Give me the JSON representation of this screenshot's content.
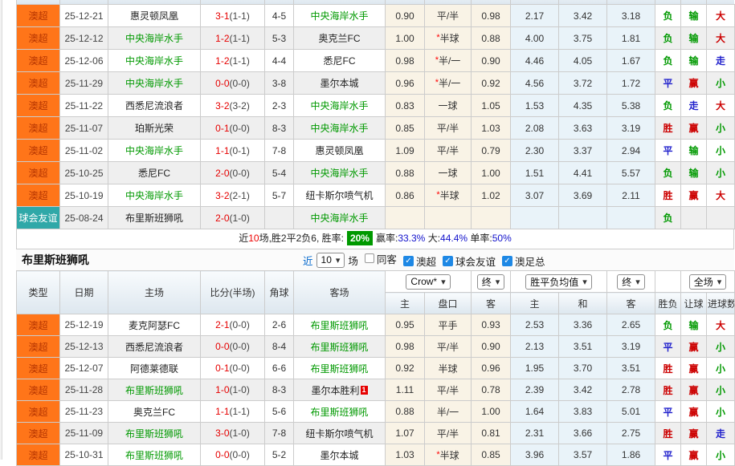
{
  "colors": {
    "league_orange": "#ff7519",
    "friendly_teal": "#2fa8a8",
    "win_red": "#cc0000",
    "draw_blue": "#2020cc",
    "lose_green": "#009900",
    "checkbox_blue": "#1e88e5",
    "rate_badge_green": "#009900"
  },
  "sub_headers": [
    "主",
    "盘口",
    "客",
    "主",
    "和",
    "客",
    "胜负",
    "让球",
    "进球数"
  ],
  "top_table": {
    "rows": [
      {
        "league": "澳超",
        "league_type": "super",
        "date": "25-12-21",
        "home": "惠灵顿凤凰",
        "home_focus": false,
        "score": "3-1",
        "half": "(1-1)",
        "corner": "4-5",
        "away": "中央海岸水手",
        "away_focus": true,
        "asian_home": "0.90",
        "handicap": "平/半",
        "handicap_star": false,
        "asian_away": "0.98",
        "euro_home": "2.17",
        "euro_draw": "3.42",
        "euro_away": "3.18",
        "result": {
          "text": "负",
          "color": "green"
        },
        "handicap_result": {
          "text": "输",
          "color": "green"
        },
        "goals": {
          "text": "大",
          "color": "red"
        }
      },
      {
        "league": "澳超",
        "league_type": "super",
        "date": "25-12-12",
        "home": "中央海岸水手",
        "home_focus": true,
        "score": "1-2",
        "half": "(1-1)",
        "corner": "5-3",
        "away": "奥克兰FC",
        "away_focus": false,
        "asian_home": "1.00",
        "handicap": "半球",
        "handicap_star": true,
        "asian_away": "0.88",
        "euro_home": "4.00",
        "euro_draw": "3.75",
        "euro_away": "1.81",
        "result": {
          "text": "负",
          "color": "green"
        },
        "handicap_result": {
          "text": "输",
          "color": "green"
        },
        "goals": {
          "text": "大",
          "color": "red"
        }
      },
      {
        "league": "澳超",
        "league_type": "super",
        "date": "25-12-06",
        "home": "中央海岸水手",
        "home_focus": true,
        "score": "1-2",
        "half": "(1-1)",
        "corner": "4-4",
        "away": "悉尼FC",
        "away_focus": false,
        "asian_home": "0.98",
        "handicap": "半/一",
        "handicap_star": true,
        "asian_away": "0.90",
        "euro_home": "4.46",
        "euro_draw": "4.05",
        "euro_away": "1.67",
        "result": {
          "text": "负",
          "color": "green"
        },
        "handicap_result": {
          "text": "输",
          "color": "green"
        },
        "goals": {
          "text": "走",
          "color": "blue"
        }
      },
      {
        "league": "澳超",
        "league_type": "super",
        "date": "25-11-29",
        "home": "中央海岸水手",
        "home_focus": true,
        "score": "0-0",
        "half": "(0-0)",
        "corner": "3-8",
        "away": "墨尔本城",
        "away_focus": false,
        "asian_home": "0.96",
        "handicap": "半/一",
        "handicap_star": true,
        "asian_away": "0.92",
        "euro_home": "4.56",
        "euro_draw": "3.72",
        "euro_away": "1.72",
        "result": {
          "text": "平",
          "color": "blue"
        },
        "handicap_result": {
          "text": "赢",
          "color": "red"
        },
        "goals": {
          "text": "小",
          "color": "green"
        }
      },
      {
        "league": "澳超",
        "league_type": "super",
        "date": "25-11-22",
        "home": "西悉尼流浪者",
        "home_focus": false,
        "score": "3-2",
        "half": "(3-2)",
        "corner": "2-3",
        "away": "中央海岸水手",
        "away_focus": true,
        "asian_home": "0.83",
        "handicap": "一球",
        "handicap_star": false,
        "asian_away": "1.05",
        "euro_home": "1.53",
        "euro_draw": "4.35",
        "euro_away": "5.38",
        "result": {
          "text": "负",
          "color": "green"
        },
        "handicap_result": {
          "text": "走",
          "color": "blue"
        },
        "goals": {
          "text": "大",
          "color": "red"
        }
      },
      {
        "league": "澳超",
        "league_type": "super",
        "date": "25-11-07",
        "home": "珀斯光荣",
        "home_focus": false,
        "score": "0-1",
        "half": "(0-0)",
        "corner": "8-3",
        "away": "中央海岸水手",
        "away_focus": true,
        "asian_home": "0.85",
        "handicap": "平/半",
        "handicap_star": false,
        "asian_away": "1.03",
        "euro_home": "2.08",
        "euro_draw": "3.63",
        "euro_away": "3.19",
        "result": {
          "text": "胜",
          "color": "red"
        },
        "handicap_result": {
          "text": "赢",
          "color": "red"
        },
        "goals": {
          "text": "小",
          "color": "green"
        }
      },
      {
        "league": "澳超",
        "league_type": "super",
        "date": "25-11-02",
        "home": "中央海岸水手",
        "home_focus": true,
        "score": "1-1",
        "half": "(0-1)",
        "corner": "7-8",
        "away": "惠灵顿凤凰",
        "away_focus": false,
        "asian_home": "1.09",
        "handicap": "平/半",
        "handicap_star": false,
        "asian_away": "0.79",
        "euro_home": "2.30",
        "euro_draw": "3.37",
        "euro_away": "2.94",
        "result": {
          "text": "平",
          "color": "blue"
        },
        "handicap_result": {
          "text": "输",
          "color": "green"
        },
        "goals": {
          "text": "小",
          "color": "green"
        }
      },
      {
        "league": "澳超",
        "league_type": "super",
        "date": "25-10-25",
        "home": "悉尼FC",
        "home_focus": false,
        "score": "2-0",
        "half": "(0-0)",
        "corner": "5-4",
        "away": "中央海岸水手",
        "away_focus": true,
        "asian_home": "0.88",
        "handicap": "一球",
        "handicap_star": false,
        "asian_away": "1.00",
        "euro_home": "1.51",
        "euro_draw": "4.41",
        "euro_away": "5.57",
        "result": {
          "text": "负",
          "color": "green"
        },
        "handicap_result": {
          "text": "输",
          "color": "green"
        },
        "goals": {
          "text": "小",
          "color": "green"
        }
      },
      {
        "league": "澳超",
        "league_type": "super",
        "date": "25-10-19",
        "home": "中央海岸水手",
        "home_focus": true,
        "score": "3-2",
        "half": "(2-1)",
        "corner": "5-7",
        "away": "纽卡斯尔喷气机",
        "away_focus": false,
        "asian_home": "0.86",
        "handicap": "半球",
        "handicap_star": true,
        "asian_away": "1.02",
        "euro_home": "3.07",
        "euro_draw": "3.69",
        "euro_away": "2.11",
        "result": {
          "text": "胜",
          "color": "red"
        },
        "handicap_result": {
          "text": "赢",
          "color": "red"
        },
        "goals": {
          "text": "大",
          "color": "red"
        }
      },
      {
        "league": "球会友谊",
        "league_type": "friendly",
        "date": "25-08-24",
        "home": "布里斯班狮吼",
        "home_focus": false,
        "score": "2-0",
        "half": "(1-0)",
        "corner": "",
        "away": "中央海岸水手",
        "away_focus": true,
        "asian_home": "",
        "handicap": "",
        "handicap_star": false,
        "asian_away": "",
        "euro_home": "",
        "euro_draw": "",
        "euro_away": "",
        "result": {
          "text": "负",
          "color": "green"
        },
        "handicap_result": {
          "text": "",
          "color": ""
        },
        "goals": {
          "text": "",
          "color": ""
        }
      }
    ],
    "summary_segments": [
      {
        "text": "近",
        "style": "black"
      },
      {
        "text": "10",
        "style": "red"
      },
      {
        "text": "场,胜2平2负6, 胜率:",
        "style": "black"
      },
      {
        "text": "20%",
        "style": "badge"
      },
      {
        "text": "赢率:",
        "style": "black"
      },
      {
        "text": "33.3%",
        "style": "blue"
      },
      {
        "text": " 大:",
        "style": "black"
      },
      {
        "text": "44.4%",
        "style": "blue"
      },
      {
        "text": " 单率:",
        "style": "black"
      },
      {
        "text": "50%",
        "style": "blue"
      }
    ]
  },
  "section": {
    "title": "布里斯班狮吼",
    "near": "近",
    "matches_value": "10",
    "games": "场",
    "filters": [
      {
        "label": "同客",
        "checked": false
      },
      {
        "label": "澳超",
        "checked": true
      },
      {
        "label": "球会友谊",
        "checked": true
      },
      {
        "label": "澳足总",
        "checked": true
      }
    ]
  },
  "bottom_table": {
    "headers": {
      "type": "类型",
      "date": "日期",
      "home": "主场",
      "score": "比分(半场)",
      "corner": "角球",
      "away": "客场"
    },
    "dropdowns": [
      {
        "label": "Crow*"
      },
      {
        "label": "终"
      },
      {
        "label": "胜平负均值"
      },
      {
        "label": "终"
      },
      {
        "label": "全场"
      }
    ],
    "rows": [
      {
        "league": "澳超",
        "league_type": "super",
        "date": "25-12-19",
        "home": "麦克阿瑟FC",
        "home_focus": false,
        "score": "2-1",
        "half": "(0-0)",
        "corner": "2-6",
        "away": "布里斯班狮吼",
        "away_focus": true,
        "asian_home": "0.95",
        "handicap": "平手",
        "handicap_star": false,
        "asian_away": "0.93",
        "euro_home": "2.53",
        "euro_draw": "3.36",
        "euro_away": "2.65",
        "result": {
          "text": "负",
          "color": "green"
        },
        "handicap_result": {
          "text": "输",
          "color": "green"
        },
        "goals": {
          "text": "大",
          "color": "red"
        }
      },
      {
        "league": "澳超",
        "league_type": "super",
        "date": "25-12-13",
        "home": "西悉尼流浪者",
        "home_focus": false,
        "score": "0-0",
        "half": "(0-0)",
        "corner": "8-4",
        "away": "布里斯班狮吼",
        "away_focus": true,
        "asian_home": "0.98",
        "handicap": "平/半",
        "handicap_star": false,
        "asian_away": "0.90",
        "euro_home": "2.13",
        "euro_draw": "3.51",
        "euro_away": "3.19",
        "result": {
          "text": "平",
          "color": "blue"
        },
        "handicap_result": {
          "text": "赢",
          "color": "red"
        },
        "goals": {
          "text": "小",
          "color": "green"
        }
      },
      {
        "league": "澳超",
        "league_type": "super",
        "date": "25-12-07",
        "home": "阿德莱德联",
        "home_focus": false,
        "score": "0-1",
        "half": "(0-0)",
        "corner": "6-6",
        "away": "布里斯班狮吼",
        "away_focus": true,
        "asian_home": "0.92",
        "handicap": "半球",
        "handicap_star": false,
        "asian_away": "0.96",
        "euro_home": "1.95",
        "euro_draw": "3.70",
        "euro_away": "3.51",
        "result": {
          "text": "胜",
          "color": "red"
        },
        "handicap_result": {
          "text": "赢",
          "color": "red"
        },
        "goals": {
          "text": "小",
          "color": "green"
        }
      },
      {
        "league": "澳超",
        "league_type": "super",
        "date": "25-11-28",
        "home": "布里斯班狮吼",
        "home_focus": true,
        "score": "1-0",
        "half": "(1-0)",
        "corner": "8-3",
        "away": "墨尔本胜利",
        "away_focus": false,
        "away_badge": "1",
        "asian_home": "1.11",
        "handicap": "平/半",
        "handicap_star": false,
        "asian_away": "0.78",
        "euro_home": "2.39",
        "euro_draw": "3.42",
        "euro_away": "2.78",
        "result": {
          "text": "胜",
          "color": "red"
        },
        "handicap_result": {
          "text": "赢",
          "color": "red"
        },
        "goals": {
          "text": "小",
          "color": "green"
        }
      },
      {
        "league": "澳超",
        "league_type": "super",
        "date": "25-11-23",
        "home": "奥克兰FC",
        "home_focus": false,
        "score": "1-1",
        "half": "(1-1)",
        "corner": "5-6",
        "away": "布里斯班狮吼",
        "away_focus": true,
        "asian_home": "0.88",
        "handicap": "半/一",
        "handicap_star": false,
        "asian_away": "1.00",
        "euro_home": "1.64",
        "euro_draw": "3.83",
        "euro_away": "5.01",
        "result": {
          "text": "平",
          "color": "blue"
        },
        "handicap_result": {
          "text": "赢",
          "color": "red"
        },
        "goals": {
          "text": "小",
          "color": "green"
        }
      },
      {
        "league": "澳超",
        "league_type": "super",
        "date": "25-11-09",
        "home": "布里斯班狮吼",
        "home_focus": true,
        "score": "3-0",
        "half": "(1-0)",
        "corner": "7-8",
        "away": "纽卡斯尔喷气机",
        "away_focus": false,
        "asian_home": "1.07",
        "handicap": "平/半",
        "handicap_star": false,
        "asian_away": "0.81",
        "euro_home": "2.31",
        "euro_draw": "3.66",
        "euro_away": "2.75",
        "result": {
          "text": "胜",
          "color": "red"
        },
        "handicap_result": {
          "text": "赢",
          "color": "red"
        },
        "goals": {
          "text": "走",
          "color": "blue"
        }
      },
      {
        "league": "澳超",
        "league_type": "super",
        "date": "25-10-31",
        "home": "布里斯班狮吼",
        "home_focus": true,
        "score": "0-0",
        "half": "(0-0)",
        "corner": "5-2",
        "away": "墨尔本城",
        "away_focus": false,
        "asian_home": "1.03",
        "handicap": "半球",
        "handicap_star": true,
        "asian_away": "0.85",
        "euro_home": "3.96",
        "euro_draw": "3.57",
        "euro_away": "1.86",
        "result": {
          "text": "平",
          "color": "blue"
        },
        "handicap_result": {
          "text": "赢",
          "color": "red"
        },
        "goals": {
          "text": "小",
          "color": "green"
        }
      }
    ]
  }
}
